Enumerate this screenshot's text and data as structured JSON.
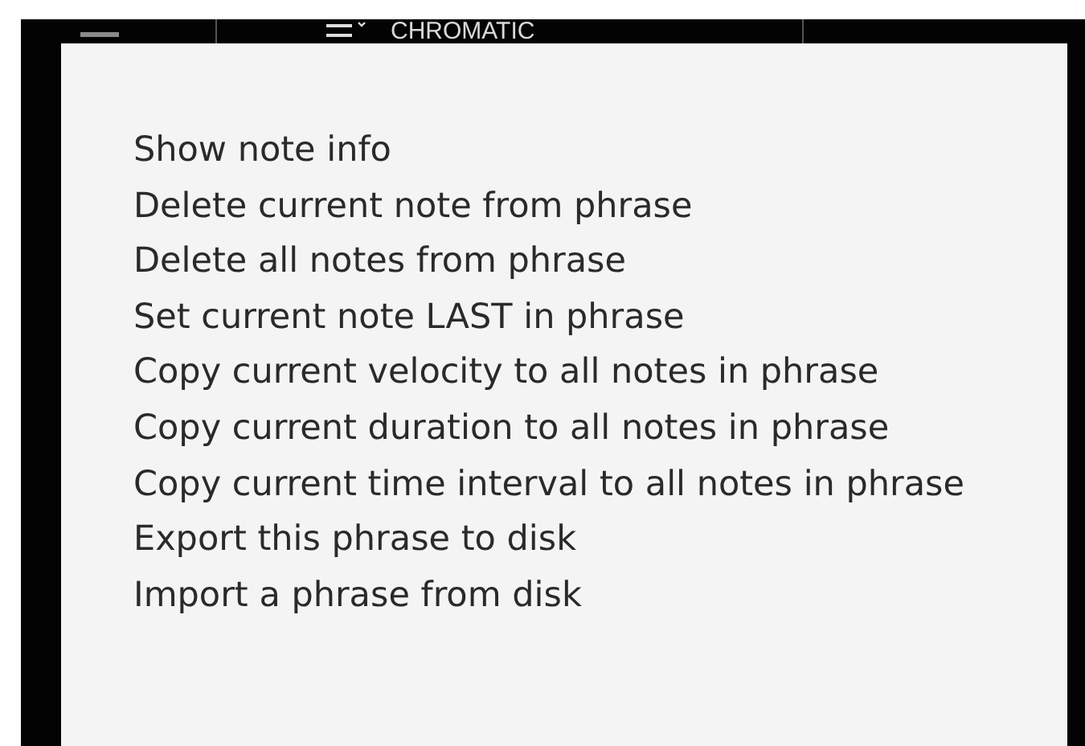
{
  "header": {
    "scale_label": "CHROMATIC"
  },
  "menu": {
    "items": [
      {
        "label": "Show note info"
      },
      {
        "label": "Delete current note from phrase"
      },
      {
        "label": "Delete all notes from phrase"
      },
      {
        "label": "Set current note LAST in phrase"
      },
      {
        "label": "Copy current velocity to all notes in phrase"
      },
      {
        "label": "Copy current duration to all notes in phrase"
      },
      {
        "label": "Copy current time interval to all notes in phrase"
      },
      {
        "label": "Export this phrase to disk"
      },
      {
        "label": "Import a phrase from disk"
      }
    ]
  }
}
